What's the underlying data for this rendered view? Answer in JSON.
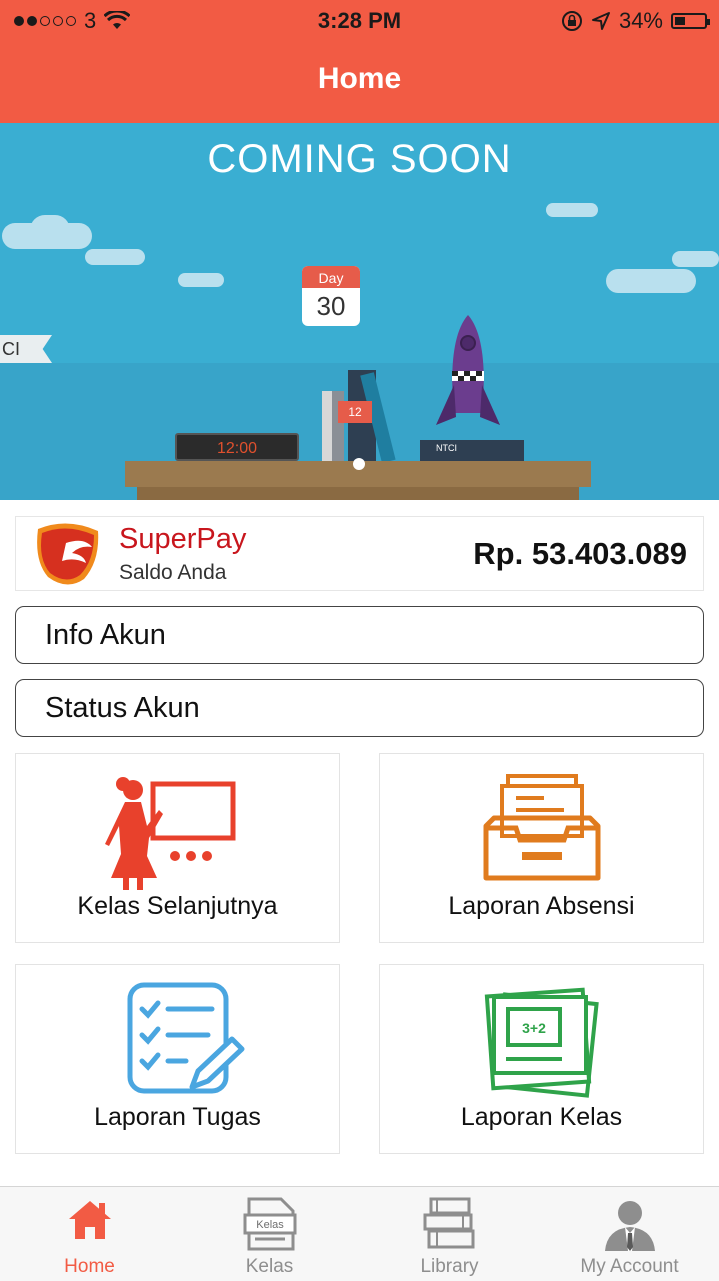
{
  "status_bar": {
    "carrier": "3",
    "time": "3:28 PM",
    "battery": "34%",
    "battery_level": 0.34
  },
  "nav": {
    "title": "Home"
  },
  "banner": {
    "headline": "COMING SOON",
    "calendar_label": "Day",
    "calendar_day": "30",
    "clock_time": "12:00",
    "flag_text": "CI",
    "book_number": "12",
    "rocket_base_text": "NTCI"
  },
  "superpay": {
    "name": "SuperPay",
    "subtitle": "Saldo Anda",
    "balance": "Rp. 53.403.089"
  },
  "buttons": {
    "info_akun": "Info Akun",
    "status_akun": "Status Akun"
  },
  "tiles": [
    {
      "label": "Kelas Selanjutnya",
      "icon": "teacher-board-icon"
    },
    {
      "label": "Laporan Absensi",
      "icon": "file-tray-icon"
    },
    {
      "label": "Laporan Tugas",
      "icon": "checklist-pencil-icon"
    },
    {
      "label": "Laporan Kelas",
      "icon": "chalkboard-icon"
    }
  ],
  "chalkboard_text": "3+2",
  "kelas_tab_icon_text": "Kelas",
  "tab_bar": {
    "items": [
      {
        "label": "Home",
        "icon": "home-icon",
        "active": true
      },
      {
        "label": "Kelas",
        "icon": "kelas-icon",
        "active": false
      },
      {
        "label": "Library",
        "icon": "library-icon",
        "active": false
      },
      {
        "label": "My Account",
        "icon": "account-icon",
        "active": false
      }
    ]
  },
  "colors": {
    "brand": "#f25b44",
    "banner": "#3aaed2",
    "superpay_red": "#c8161d"
  }
}
